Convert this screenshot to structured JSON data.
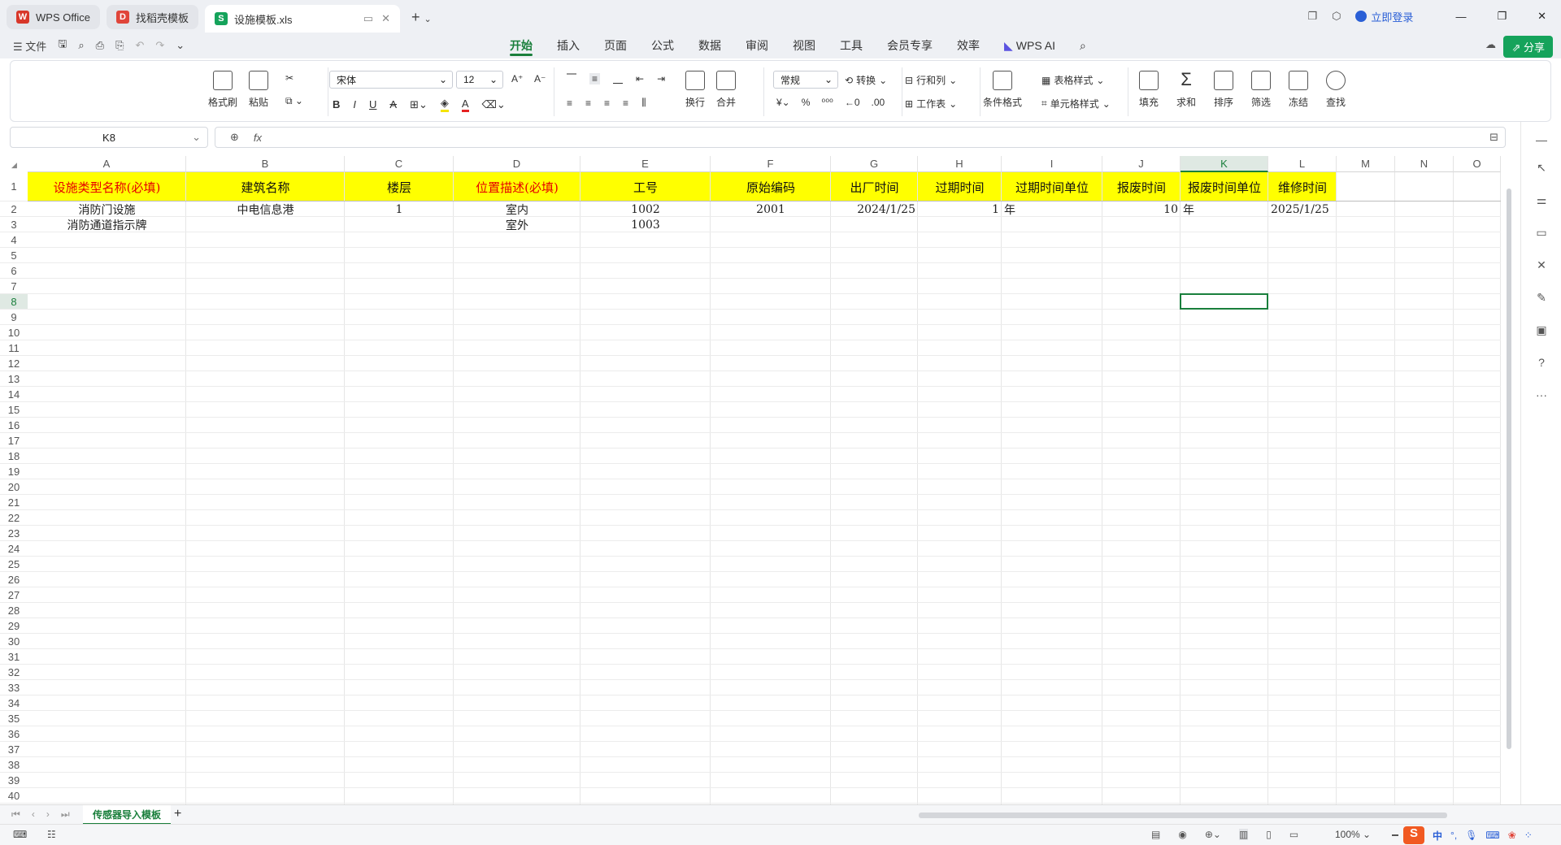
{
  "tabs": [
    {
      "label": "WPS Office",
      "icon_color": "#d8372a"
    },
    {
      "label": "找稻壳模板",
      "icon_color": "#e0453a"
    },
    {
      "label": "设施模板.xls",
      "icon_color": "#15a35b"
    }
  ],
  "window": {
    "login": "立即登录"
  },
  "menu": {
    "file": "文件",
    "tabs": [
      "开始",
      "插入",
      "页面",
      "公式",
      "数据",
      "审阅",
      "视图",
      "工具",
      "会员专享",
      "效率",
      "WPS AI"
    ],
    "active_tab": "开始",
    "share": "分享"
  },
  "ribbon": {
    "format_painter": "格式刷",
    "paste": "粘贴",
    "font": "宋体",
    "font_size": "12",
    "wrap": "换行",
    "merge": "合并",
    "number_format": "常规",
    "convert": "转换",
    "row_col": "行和列",
    "worksheet": "工作表",
    "cond_format": "条件格式",
    "table_style": "表格样式",
    "cell_style": "单元格样式",
    "fill": "填充",
    "sum": "求和",
    "sort": "排序",
    "filter": "筛选",
    "freeze": "冻结",
    "find": "查找"
  },
  "formula_bar": {
    "name_box": "K8",
    "fx": "fx",
    "value": ""
  },
  "sheet": {
    "columns": [
      "A",
      "B",
      "C",
      "D",
      "E",
      "F",
      "G",
      "H",
      "I",
      "J",
      "K",
      "L",
      "M",
      "N",
      "O"
    ],
    "active_column": "K",
    "active_row": 8,
    "row_count": 40,
    "header_row": [
      "设施类型名称(必填)",
      "建筑名称",
      "楼层",
      "位置描述(必填)",
      "工号",
      "原始编码",
      "出厂时间",
      "过期时间",
      "过期时间单位",
      "报废时间",
      "报废时间单位",
      "维修时间"
    ],
    "header_red_cols": [
      0,
      3
    ],
    "header_bg": "#ffff00",
    "rows": [
      [
        "消防门设施",
        "中电信息港",
        "1",
        "室内",
        "1002",
        "2001",
        "2024/1/25",
        "1",
        "年",
        "10",
        "年",
        "2025/1/25"
      ],
      [
        "消防通道指示牌",
        "",
        "",
        "室外",
        "1003",
        "",
        "",
        "",
        "",
        "",
        "",
        ""
      ]
    ]
  },
  "sheet_tabs": {
    "active": "传感器导入模板",
    "add": "+"
  },
  "status": {
    "zoom": "100%"
  }
}
